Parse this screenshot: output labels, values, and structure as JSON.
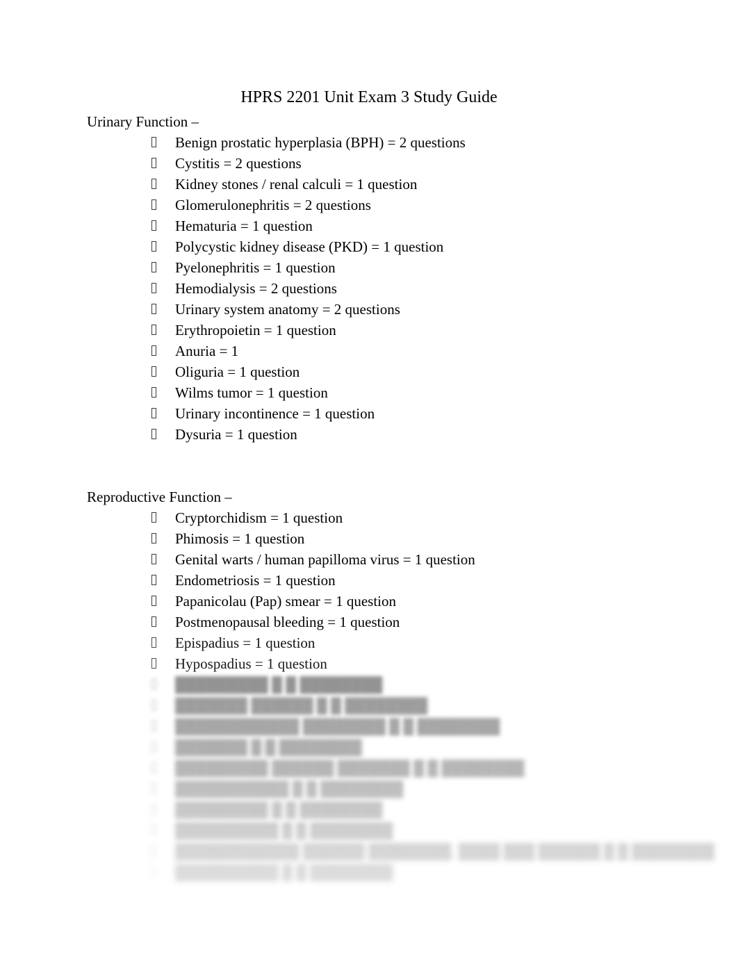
{
  "document": {
    "title": "HPRS 2201 Unit Exam 3 Study Guide",
    "background_color": "#ffffff",
    "text_color": "#000000",
    "bullet_glyph": "missing-glyph-box"
  },
  "sections": [
    {
      "heading": "Urinary Function –",
      "items": [
        "Benign prostatic hyperplasia (BPH) = 2 questions",
        "Cystitis = 2 questions",
        "Kidney stones / renal calculi = 1 question",
        "Glomerulonephritis = 2 questions",
        "Hematuria = 1 question",
        "Polycystic kidney disease (PKD) = 1 question",
        "Pyelonephritis = 1 question",
        "Hemodialysis = 2 questions",
        "Urinary system anatomy = 2 questions",
        "Erythropoietin = 1 question",
        "Anuria = 1",
        "Oliguria = 1 question",
        "Wilms tumor = 1 question",
        "Urinary incontinence = 1 question",
        "Dysuria = 1 question"
      ]
    },
    {
      "heading": "Reproductive Function –",
      "items": [
        "Cryptorchidism = 1 question",
        "Phimosis = 1 question",
        "Genital warts / human papilloma virus = 1 question",
        "Endometriosis = 1 question",
        "Papanicolau (Pap) smear = 1 question",
        "Postmenopausal bleeding = 1 question",
        "Epispadius = 1 question",
        "Hypospadius = 1 question"
      ]
    }
  ],
  "obscured_preview": {
    "note": "Remaining lines are blurred and unreadable in the screenshot",
    "lines": [
      "█████████ █ █ ████████",
      "███████ ██████ █ █ ████████",
      "████████████ ████████ █ █ ████████",
      "███████ █ █ ████████",
      "█████████ ██████ ███████ █ █ ████████",
      "███████████ █ █ ████████",
      "█████████ █ █ ████████",
      "██████████ █ █ ████████",
      "████████████ ██████ ████████, ████ ███ ██████ █ █ ████████",
      "██████████ █ █ ████████"
    ]
  }
}
